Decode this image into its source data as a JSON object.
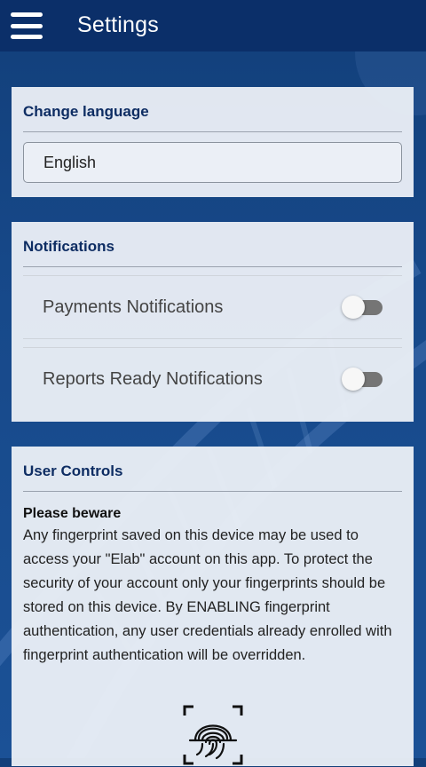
{
  "header": {
    "title": "Settings"
  },
  "language": {
    "header": "Change language",
    "selected": "English"
  },
  "notifications": {
    "header": "Notifications",
    "items": [
      {
        "label": "Payments Notifications",
        "enabled": false
      },
      {
        "label": "Reports Ready Notifications",
        "enabled": false
      }
    ]
  },
  "user_controls": {
    "header": "User Controls",
    "warning_title": "Please beware",
    "warning_text": "Any fingerprint saved on this device may be used to access your \"Elab\" account on this app. To protect the security of your account only your fingerprints should be stored on this device. By ENABLING fingerprint authentication, any user credentials already enrolled with fingerprint authentication will be overridden."
  },
  "colors": {
    "appbar": "#0b2f69",
    "background": "#17498a",
    "card": "#ecf0f7",
    "header_text": "#0e2d63",
    "toggle_track": "#757575"
  },
  "icons": {
    "menu": "hamburger-menu-icon",
    "fingerprint": "fingerprint-scan-icon"
  }
}
